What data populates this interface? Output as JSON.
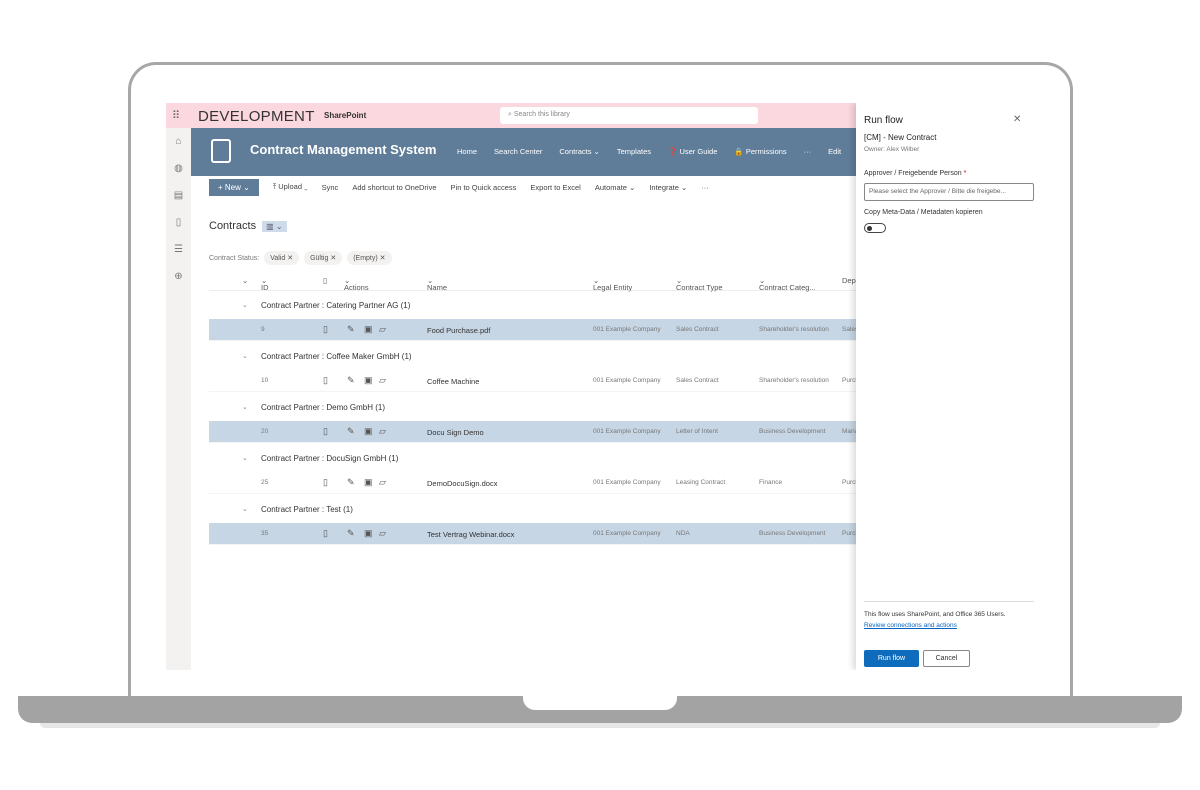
{
  "topbar": {
    "site": "DEVELOPMENT",
    "app": "SharePoint",
    "search_placeholder": "Search this library"
  },
  "header": {
    "title": "Contract Management System",
    "nav": [
      "Home",
      "Search Center",
      "Contracts ⌄",
      "Templates",
      "❓ User Guide",
      "🔒 Permissions",
      "···",
      "Edit"
    ]
  },
  "commands": {
    "new": "+ New ⌄",
    "items": [
      "⤒ Upload ⌄",
      "Sync",
      "Add shortcut to OneDrive",
      "Pin to Quick access",
      "Export to Excel",
      "Automate ⌄",
      "Integrate ⌄",
      "···"
    ]
  },
  "list": {
    "title": "Contracts",
    "view_icon": "library-icon",
    "filter_label": "Contract Status:",
    "filters": [
      "Valid",
      "Gültig",
      "(Empty)"
    ],
    "columns": [
      "ID",
      "Actions",
      "Name",
      "Legal Entity",
      "Contract Type",
      "Contract Categ...",
      "Dep"
    ],
    "groups": [
      {
        "label": "Contract Partner : Catering Partner AG (1)",
        "row": {
          "id": "9",
          "name": "Food Purchase.pdf",
          "entity": "001 Example Company",
          "type": "Sales Contract",
          "category": "Shareholder's resolution",
          "dep": "Sales",
          "selected": true
        }
      },
      {
        "label": "Contract Partner : Coffee Maker GmbH (1)",
        "row": {
          "id": "10",
          "name": "Coffee Machine",
          "entity": "001 Example Company",
          "type": "Sales Contract",
          "category": "Shareholder's resolution",
          "dep": "Purch",
          "selected": false
        }
      },
      {
        "label": "Contract Partner : Demo GmbH (1)",
        "row": {
          "id": "20",
          "name": "Docu Sign Demo",
          "entity": "001 Example Company",
          "type": "Letter of Intent",
          "category": "Business Development",
          "dep": "Mana",
          "selected": true
        }
      },
      {
        "label": "Contract Partner : DocuSign GmbH (1)",
        "row": {
          "id": "25",
          "name": "DemoDocuSign.docx",
          "entity": "001 Example Company",
          "type": "Leasing Contract",
          "category": "Finance",
          "dep": "Purch",
          "selected": false
        }
      },
      {
        "label": "Contract Partner : Test (1)",
        "row": {
          "id": "35",
          "name": "Test Vertrag Webinar.docx",
          "entity": "001 Example Company",
          "type": "NDA",
          "category": "Business Development",
          "dep": "Purch",
          "selected": true
        }
      }
    ]
  },
  "panel": {
    "title": "Run flow",
    "flow_name": "[CM] - New Contract",
    "owner": "Owner: Alex Wilber",
    "approver_label": "Approver / Freigebende Person",
    "required": "*",
    "approver_placeholder": "Please select the Approver / Bitte die freigebe...",
    "copy_label": "Copy Meta-Data / Metadaten kopieren",
    "copy_on": false,
    "note": "This flow uses SharePoint, and Office 365 Users.",
    "review_link": "Review connections and actions",
    "run": "Run flow",
    "cancel": "Cancel"
  },
  "colors": {
    "header": "#5f7d99",
    "topbar": "#fbd7df",
    "selected_row": "#c7d6e5",
    "primary": "#0f6cbd"
  }
}
